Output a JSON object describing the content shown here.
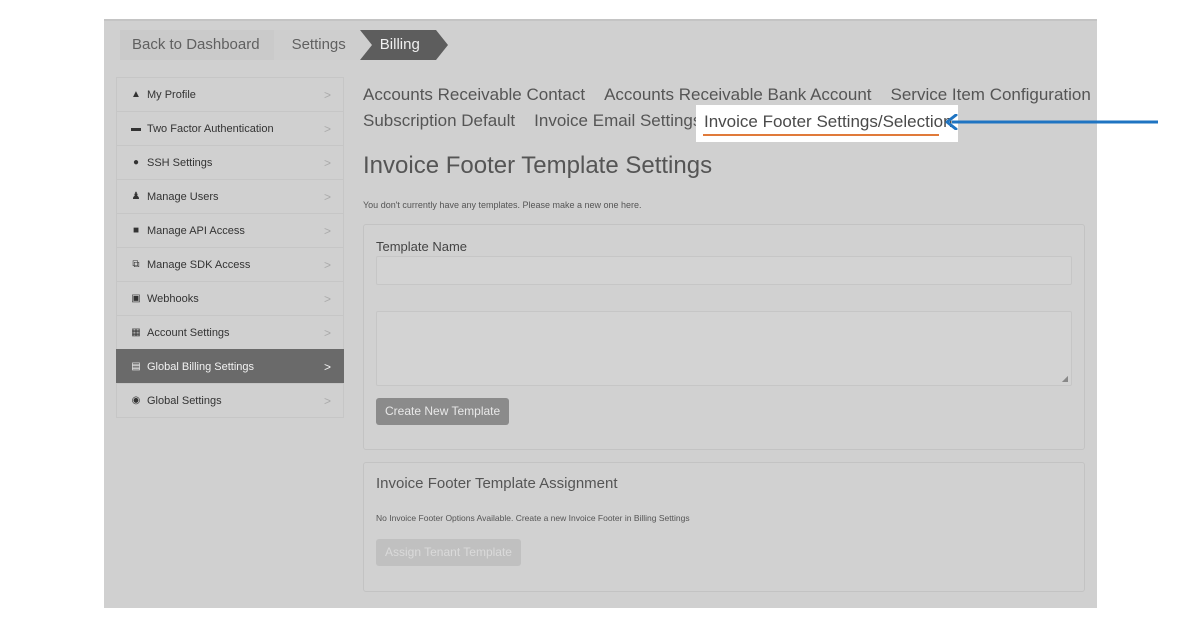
{
  "breadcrumb": [
    "Back to Dashboard",
    "Settings",
    "Billing"
  ],
  "sidebar": {
    "items": [
      {
        "icon": "person-icon",
        "glyph": "▲",
        "label": "My Profile"
      },
      {
        "icon": "briefcase-icon",
        "glyph": "▬",
        "label": "Two Factor Authentication"
      },
      {
        "icon": "key-icon",
        "glyph": "●",
        "label": "SSH Settings"
      },
      {
        "icon": "users-icon",
        "glyph": "♟",
        "label": "Manage Users"
      },
      {
        "icon": "api-icon",
        "glyph": "■",
        "label": "Manage API Access"
      },
      {
        "icon": "sdk-icon",
        "glyph": "⧉",
        "label": "Manage SDK Access"
      },
      {
        "icon": "monitor-icon",
        "glyph": "▣",
        "label": "Webhooks"
      },
      {
        "icon": "building-icon",
        "glyph": "▦",
        "label": "Account Settings"
      },
      {
        "icon": "calculator-icon",
        "glyph": "▤",
        "label": "Global Billing Settings",
        "active": true
      },
      {
        "icon": "globe-icon",
        "glyph": "◉",
        "label": "Global Settings"
      }
    ],
    "chevron": ">"
  },
  "tabs": {
    "row1": [
      "Accounts Receivable Contact",
      "Accounts Receivable Bank Account",
      "Service Item Configuration"
    ],
    "row2": [
      "Subscription Default",
      "Invoice Email Settings"
    ],
    "selected": "Invoice Footer Settings/Selection"
  },
  "main": {
    "title": "Invoice Footer Template Settings",
    "note": "You don't currently have any templates. Please make a new one here.",
    "template_name_label": "Template Name",
    "template_name_value": "",
    "footer_text_value": "",
    "create_button": "Create New Template",
    "assignment_title": "Invoice Footer Template Assignment",
    "assignment_note": "No Invoice Footer Options Available. Create a new Invoice Footer in Billing Settings",
    "assign_button": "Assign Tenant Template"
  },
  "colors": {
    "accent_underline": "#e07a3a",
    "annotation_arrow": "#1f74c2",
    "active_sidebar": "#6a6a6a"
  }
}
